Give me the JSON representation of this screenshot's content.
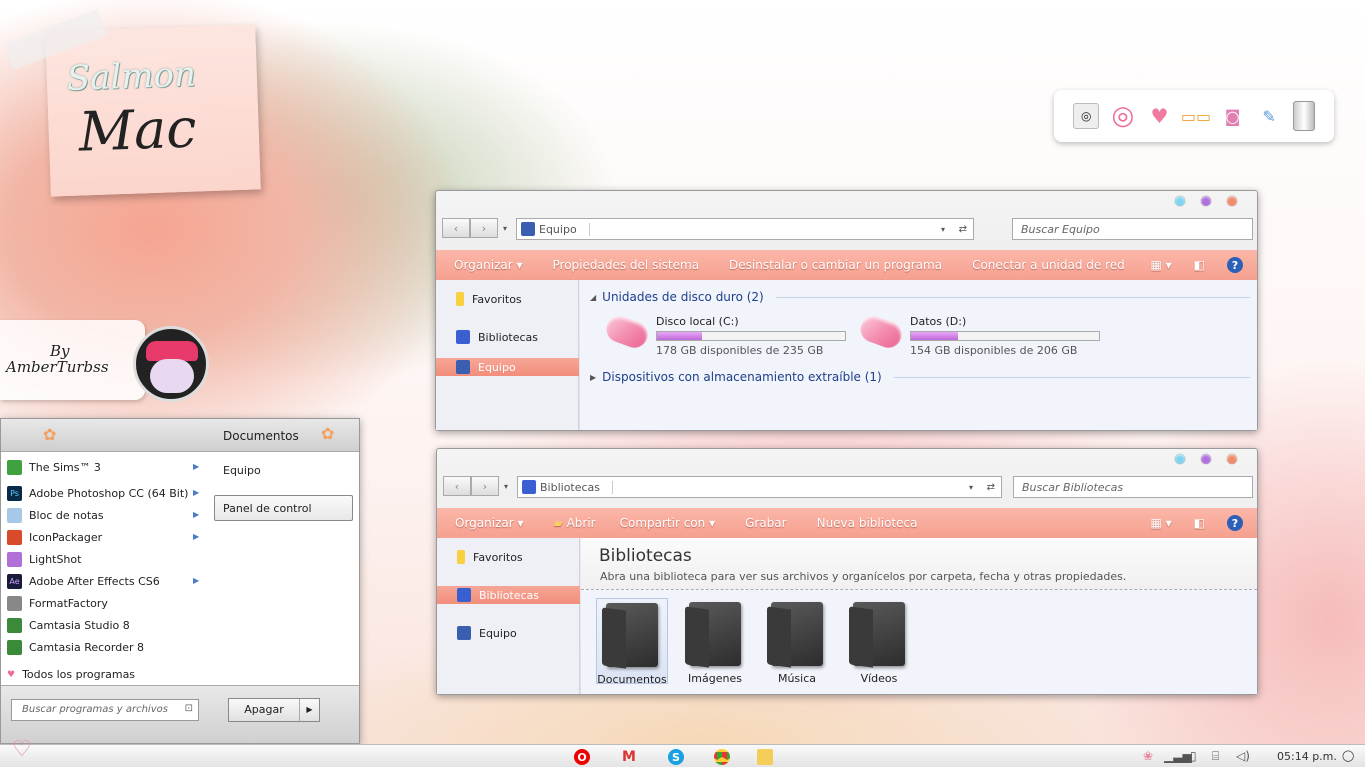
{
  "wallpaper": {
    "note_line1": "Salmon",
    "note_line2": "Mac",
    "author_line1": "By",
    "author_line2": "AmberTurbss"
  },
  "window1": {
    "address": "Equipo",
    "search_placeholder": "Buscar Equipo",
    "toolbar": [
      "Organizar ▾",
      "Propiedades del sistema",
      "Desinstalar o cambiar un programa",
      "Conectar a unidad de red",
      "›"
    ],
    "sidebar": [
      "Favoritos",
      "Bibliotecas",
      "Equipo"
    ],
    "group1": "Unidades de disco duro (2)",
    "group2": "Dispositivos con almacenamiento extraíble (1)",
    "drives": [
      {
        "name": "Disco local (C:)",
        "free": "178 GB disponibles de 235 GB",
        "used_fraction": 0.24
      },
      {
        "name": "Datos (D:)",
        "free": "154 GB disponibles de 206 GB",
        "used_fraction": 0.25
      }
    ]
  },
  "window2": {
    "address": "Bibliotecas",
    "search_placeholder": "Buscar Bibliotecas",
    "toolbar": [
      "Organizar ▾",
      "Abrir",
      "Compartir con ▾",
      "Grabar",
      "Nueva biblioteca"
    ],
    "sidebar": [
      "Favoritos",
      "Bibliotecas",
      "Equipo"
    ],
    "title": "Bibliotecas",
    "subtitle": "Abra una biblioteca para ver sus archivos y organícelos por carpeta, fecha y otras propiedades.",
    "folders": [
      "Documentos",
      "Imágenes",
      "Música",
      "Vídeos"
    ]
  },
  "start_menu": {
    "header": "Documentos",
    "programs": [
      "The Sims™ 3",
      "Adobe Photoshop CC (64 Bit)",
      "Bloc de notas",
      "IconPackager",
      "LightShot",
      "Adobe After Effects CS6",
      "FormatFactory",
      "Camtasia Studio 8",
      "Camtasia Recorder 8"
    ],
    "all_programs": "Todos los programas",
    "right": [
      "Equipo",
      "Panel de control"
    ],
    "search_placeholder": "Buscar programas y archivos",
    "shutdown": "Apagar"
  },
  "taskbar": {
    "clock": "05:14 p.m."
  },
  "colors": {
    "accent": "#f6a090",
    "selection": "#f28d7b",
    "progress": "#c06ad8"
  }
}
